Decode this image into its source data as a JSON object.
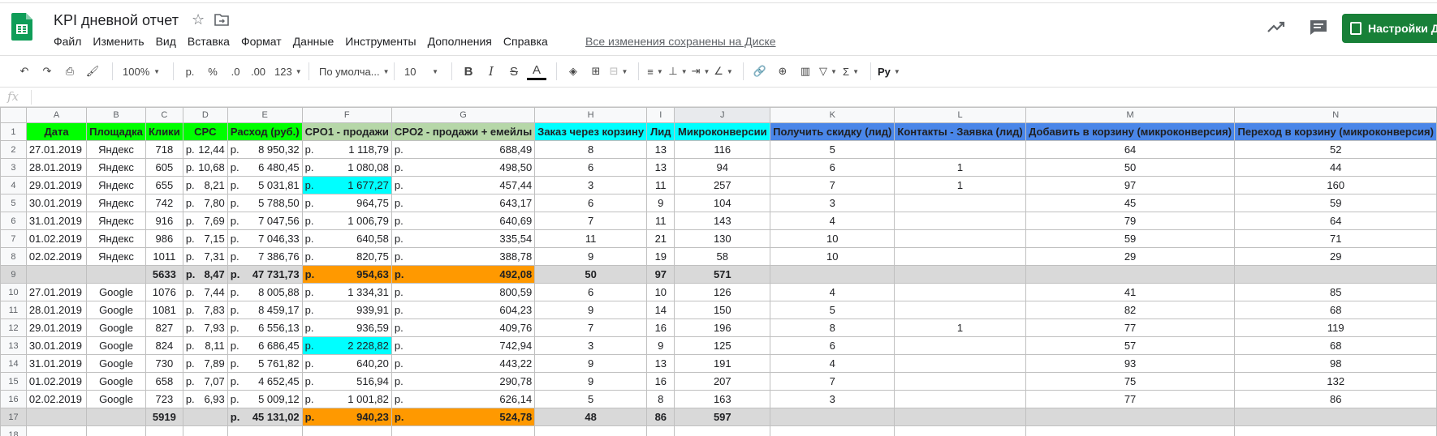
{
  "app": {
    "title": "KPI дневной отчет",
    "save_status": "Все изменения сохранены на Диске",
    "share_label": "Настройки Д",
    "menu": [
      "Файл",
      "Изменить",
      "Вид",
      "Вставка",
      "Формат",
      "Данные",
      "Инструменты",
      "Дополнения",
      "Справка"
    ],
    "icons": {
      "star": "star-icon",
      "folder": "folder-move-icon",
      "trend": "explore-trend-icon",
      "comment": "comment-icon"
    },
    "accent": "#188038"
  },
  "toolbar": {
    "zoom": "100%",
    "currency": "р.",
    "percent": "%",
    "decimal_less": ".0",
    "decimal_more": ".00",
    "format_more": "123",
    "font": "По умолча...",
    "font_size": "10",
    "bold": "B",
    "italic": "I",
    "strike": "S",
    "text_color": "A",
    "script_label": "Py"
  },
  "formula_bar": {
    "fx": "fx"
  },
  "sheet": {
    "columns": [
      "A",
      "B",
      "C",
      "D",
      "E",
      "F",
      "G",
      "H",
      "I",
      "J",
      "K",
      "L",
      "M",
      "N"
    ],
    "header_row": [
      "Дата",
      "Площадка",
      "Клики",
      "CPC",
      "Расход (руб.)",
      "CPO1 - продажи",
      "CPO2 - продажи + емейлы",
      "Заказ через корзину",
      "Лид",
      "Микроконверсии",
      "Получить скидку (лид)",
      "Контакты - Заявка (лид)",
      "Добавить в корзину (микроконверсия)",
      "Переход в корзину (микроконверсия)"
    ],
    "header_colors": [
      "#00ff00",
      "#00ff00",
      "#00ff00",
      "#00ff00",
      "#00ff00",
      "#b6d7a8",
      "#b6d7a8",
      "#00ffff",
      "#00ffff",
      "#00ffff",
      "#4a86e8",
      "#4a86e8",
      "#4a86e8",
      "#4a86e8"
    ],
    "rows": [
      [
        "27.01.2019",
        "Яндекс",
        "718",
        "12,44",
        "8 950,32",
        "1 118,79",
        "688,49",
        "8",
        "13",
        "116",
        "5",
        "",
        "64",
        "52"
      ],
      [
        "28.01.2019",
        "Яндекс",
        "605",
        "10,68",
        "6 480,45",
        "1 080,08",
        "498,50",
        "6",
        "13",
        "94",
        "6",
        "1",
        "50",
        "44"
      ],
      [
        "29.01.2019",
        "Яндекс",
        "655",
        "8,21",
        "5 031,81",
        "1 677,27",
        "457,44",
        "3",
        "11",
        "257",
        "7",
        "1",
        "97",
        "160"
      ],
      [
        "30.01.2019",
        "Яндекс",
        "742",
        "7,80",
        "5 788,50",
        "964,75",
        "643,17",
        "6",
        "9",
        "104",
        "3",
        "",
        "45",
        "59"
      ],
      [
        "31.01.2019",
        "Яндекс",
        "916",
        "7,69",
        "7 047,56",
        "1 006,79",
        "640,69",
        "7",
        "11",
        "143",
        "4",
        "",
        "79",
        "64"
      ],
      [
        "01.02.2019",
        "Яндекс",
        "986",
        "7,15",
        "7 046,33",
        "640,58",
        "335,54",
        "11",
        "21",
        "130",
        "10",
        "",
        "59",
        "71"
      ],
      [
        "02.02.2019",
        "Яндекс",
        "1011",
        "7,31",
        "7 386,76",
        "820,75",
        "388,78",
        "9",
        "19",
        "58",
        "10",
        "",
        "29",
        "29"
      ],
      [
        "",
        "",
        "5633",
        "8,47",
        "47 731,73",
        "954,63",
        "492,08",
        "50",
        "97",
        "571",
        "",
        "",
        "",
        ""
      ],
      [
        "27.01.2019",
        "Google",
        "1076",
        "7,44",
        "8 005,88",
        "1 334,31",
        "800,59",
        "6",
        "10",
        "126",
        "4",
        "",
        "41",
        "85"
      ],
      [
        "28.01.2019",
        "Google",
        "1081",
        "7,83",
        "8 459,17",
        "939,91",
        "604,23",
        "9",
        "14",
        "150",
        "5",
        "",
        "82",
        "68"
      ],
      [
        "29.01.2019",
        "Google",
        "827",
        "7,93",
        "6 556,13",
        "936,59",
        "409,76",
        "7",
        "16",
        "196",
        "8",
        "1",
        "77",
        "119"
      ],
      [
        "30.01.2019",
        "Google",
        "824",
        "8,11",
        "6 686,45",
        "2 228,82",
        "742,94",
        "3",
        "9",
        "125",
        "6",
        "",
        "57",
        "68"
      ],
      [
        "31.01.2019",
        "Google",
        "730",
        "7,89",
        "5 761,82",
        "640,20",
        "443,22",
        "9",
        "13",
        "191",
        "4",
        "",
        "93",
        "98"
      ],
      [
        "01.02.2019",
        "Google",
        "658",
        "7,07",
        "4 652,45",
        "516,94",
        "290,78",
        "9",
        "16",
        "207",
        "7",
        "",
        "75",
        "132"
      ],
      [
        "02.02.2019",
        "Google",
        "723",
        "6,93",
        "5 009,12",
        "1 001,82",
        "626,14",
        "5",
        "8",
        "163",
        "3",
        "",
        "77",
        "86"
      ],
      [
        "",
        "",
        "5919",
        "",
        "45 131,02",
        "940,23",
        "524,78",
        "48",
        "86",
        "597",
        "",
        "",
        "",
        ""
      ]
    ],
    "currency_prefix": "р.",
    "highlight_colors": {
      "total_row": "#d9d9d9",
      "max_value": "#00ffff",
      "total_cpo": "#ff9900"
    }
  }
}
